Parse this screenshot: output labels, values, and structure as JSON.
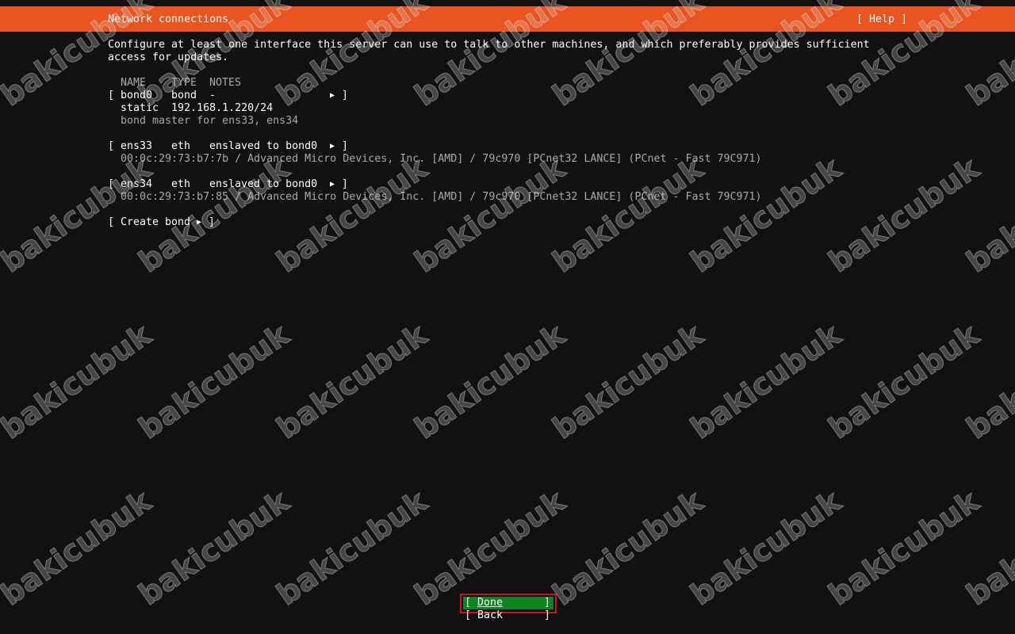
{
  "header": {
    "title": "Network connections",
    "help_label": "[ Help ]"
  },
  "description": {
    "line1": "Configure at least one interface this server can use to talk to other machines, and which preferably provides sufficient",
    "line2": "access for updates."
  },
  "table": {
    "columns": [
      "NAME",
      "TYPE",
      "NOTES"
    ],
    "interfaces": [
      {
        "name": "bond0",
        "type": "bond",
        "notes": "-",
        "details": [
          "static  192.168.1.220/24",
          "bond master for ens33, ens34"
        ]
      },
      {
        "name": "ens33",
        "type": "eth",
        "notes": "enslaved to bond0",
        "details": [
          "00:0c:29:73:b7:7b / Advanced Micro Devices, Inc. [AMD] / 79c970 [PCnet32 LANCE] (PCnet - Fast 79C971)"
        ]
      },
      {
        "name": "ens34",
        "type": "eth",
        "notes": "enslaved to bond0",
        "details": [
          "00:0c:29:73:b7:85 / Advanced Micro Devices, Inc. [AMD] / 79c970 [PCnet32 LANCE] (PCnet - Fast 79C971)"
        ]
      }
    ]
  },
  "actions": {
    "create_bond": "Create bond"
  },
  "buttons": {
    "done": "Done",
    "back": "Back"
  },
  "watermark": "bakicubuk",
  "colors": {
    "header_bg": "#e95420",
    "done_bg": "#0e8420",
    "done_outline": "#d0131b",
    "background": "#111111"
  }
}
